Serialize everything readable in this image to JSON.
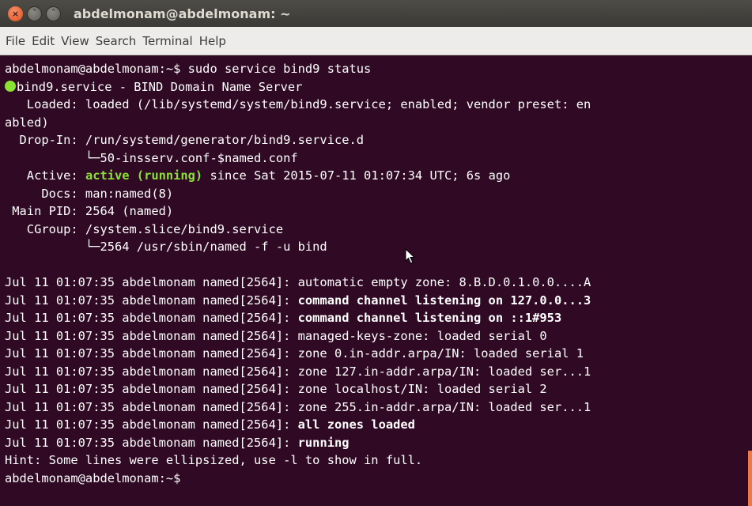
{
  "window": {
    "title": "abdelmonam@abdelmonam: ~",
    "buttons": {
      "close": "×",
      "minimize": "˅",
      "maximize": "˄"
    }
  },
  "menu": [
    "File",
    "Edit",
    "View",
    "Search",
    "Terminal",
    "Help"
  ],
  "colors": {
    "terminal_bg": "#300a24",
    "active_green": "#8ae234",
    "scrollbar": "#f07746"
  },
  "terminal": {
    "lines": [
      {
        "segs": [
          {
            "t": "abdelmonam@abdelmonam:~$ sudo service bind9 status"
          }
        ]
      },
      {
        "dot": true,
        "segs": [
          {
            "t": "bind9.service - BIND Domain Name Server"
          }
        ]
      },
      {
        "segs": [
          {
            "t": "   Loaded: loaded (/lib/systemd/system/bind9.service; enabled; vendor preset: en"
          }
        ]
      },
      {
        "segs": [
          {
            "t": "abled)"
          }
        ]
      },
      {
        "segs": [
          {
            "t": "  Drop-In: /run/systemd/generator/bind9.service.d"
          }
        ]
      },
      {
        "segs": [
          {
            "t": "           └─50-insserv.conf-$named.conf"
          }
        ]
      },
      {
        "segs": [
          {
            "t": "   Active: "
          },
          {
            "t": "active (running)",
            "s": "green"
          },
          {
            "t": " since Sat 2015-07-11 01:07:34 UTC; 6s ago"
          }
        ]
      },
      {
        "segs": [
          {
            "t": "     Docs: man:named(8)"
          }
        ]
      },
      {
        "segs": [
          {
            "t": " Main PID: 2564 (named)"
          }
        ]
      },
      {
        "segs": [
          {
            "t": "   CGroup: /system.slice/bind9.service"
          }
        ]
      },
      {
        "segs": [
          {
            "t": "           └─2564 /usr/sbin/named -f -u bind"
          }
        ]
      },
      {
        "segs": [
          {
            "t": ""
          }
        ]
      },
      {
        "segs": [
          {
            "t": "Jul 11 01:07:35 abdelmonam named[2564]: automatic empty zone: 8.B.D.0.1.0.0....A"
          }
        ]
      },
      {
        "segs": [
          {
            "t": "Jul 11 01:07:35 abdelmonam named[2564]: "
          },
          {
            "t": "command channel listening on 127.0.0...3",
            "s": "bold"
          }
        ]
      },
      {
        "segs": [
          {
            "t": "Jul 11 01:07:35 abdelmonam named[2564]: "
          },
          {
            "t": "command channel listening on ::1#953",
            "s": "bold"
          }
        ]
      },
      {
        "segs": [
          {
            "t": "Jul 11 01:07:35 abdelmonam named[2564]: managed-keys-zone: loaded serial 0"
          }
        ]
      },
      {
        "segs": [
          {
            "t": "Jul 11 01:07:35 abdelmonam named[2564]: zone 0.in-addr.arpa/IN: loaded serial 1"
          }
        ]
      },
      {
        "segs": [
          {
            "t": "Jul 11 01:07:35 abdelmonam named[2564]: zone 127.in-addr.arpa/IN: loaded ser...1"
          }
        ]
      },
      {
        "segs": [
          {
            "t": "Jul 11 01:07:35 abdelmonam named[2564]: zone localhost/IN: loaded serial 2"
          }
        ]
      },
      {
        "segs": [
          {
            "t": "Jul 11 01:07:35 abdelmonam named[2564]: zone 255.in-addr.arpa/IN: loaded ser...1"
          }
        ]
      },
      {
        "segs": [
          {
            "t": "Jul 11 01:07:35 abdelmonam named[2564]: "
          },
          {
            "t": "all zones loaded",
            "s": "bold"
          }
        ]
      },
      {
        "segs": [
          {
            "t": "Jul 11 01:07:35 abdelmonam named[2564]: "
          },
          {
            "t": "running",
            "s": "bold"
          }
        ]
      },
      {
        "segs": [
          {
            "t": "Hint: Some lines were ellipsized, use -l to show in full."
          }
        ]
      },
      {
        "segs": [
          {
            "t": "abdelmonam@abdelmonam:~$"
          }
        ]
      }
    ]
  }
}
